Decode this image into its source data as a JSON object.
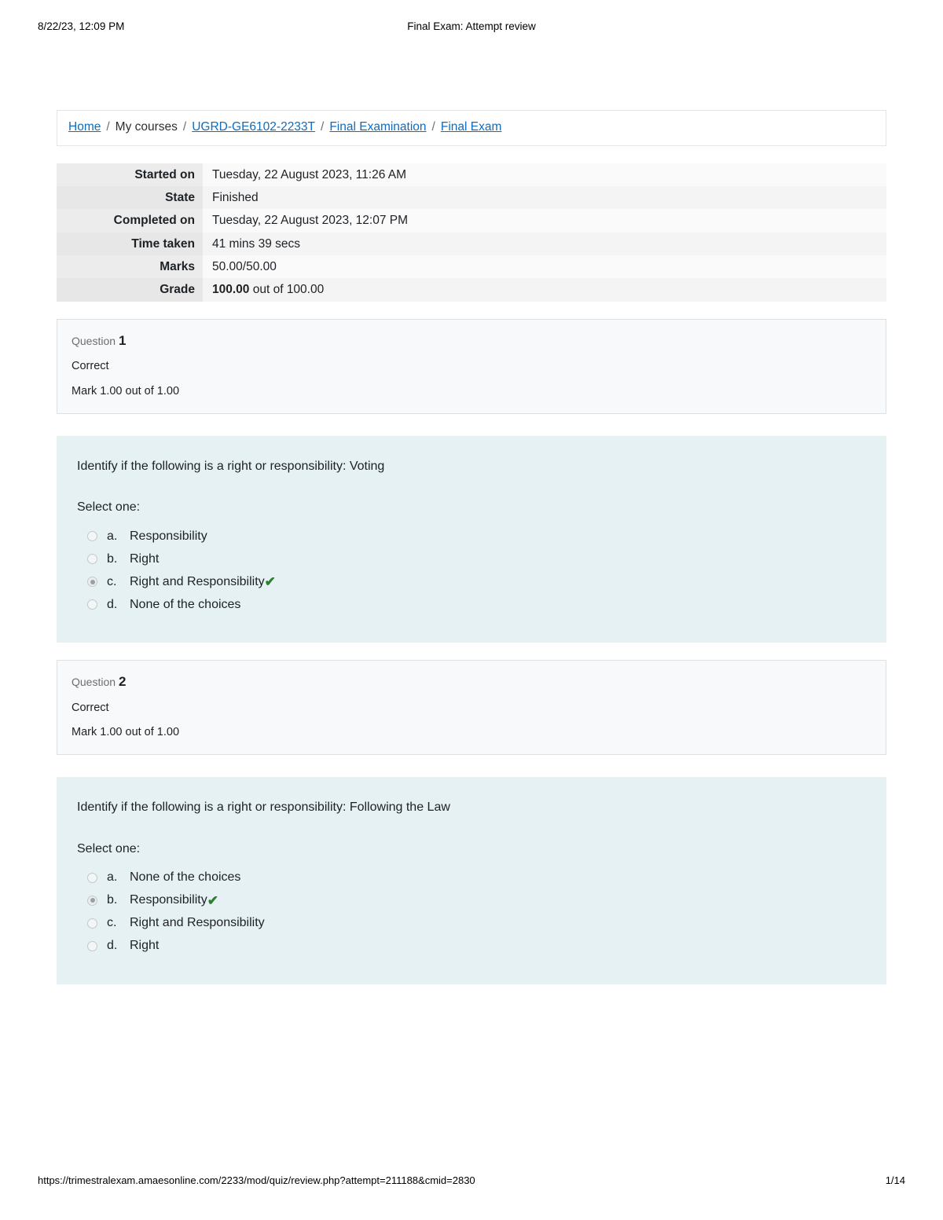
{
  "print_header": {
    "left": "8/22/23, 12:09 PM",
    "center": "Final Exam: Attempt review"
  },
  "print_footer": {
    "url": "https://trimestralexam.amaesonline.com/2233/mod/quiz/review.php?attempt=211188&cmid=2830",
    "page": "1/14"
  },
  "breadcrumb": {
    "separator": "/",
    "items": [
      {
        "label": "Home",
        "link": true
      },
      {
        "label": "My courses",
        "link": false
      },
      {
        "label": "UGRD-GE6102-2233T",
        "link": true
      },
      {
        "label": "Final Examination",
        "link": true
      },
      {
        "label": "Final Exam",
        "link": true
      }
    ]
  },
  "summary": {
    "rows": [
      {
        "key": "Started on",
        "value": "Tuesday, 22 August 2023, 11:26 AM"
      },
      {
        "key": "State",
        "value": "Finished"
      },
      {
        "key": "Completed on",
        "value": "Tuesday, 22 August 2023, 12:07 PM"
      },
      {
        "key": "Time taken",
        "value": "41 mins 39 secs"
      },
      {
        "key": "Marks",
        "value": "50.00/50.00"
      },
      {
        "key": "Grade",
        "value_strong": "100.00",
        "value_rest": " out of 100.00"
      }
    ]
  },
  "questions": [
    {
      "label": "Question",
      "number": "1",
      "state": "Correct",
      "mark": "Mark 1.00 out of 1.00",
      "text": "Identify if the following is a right or responsibility: Voting",
      "prompt": "Select one:",
      "options": [
        {
          "letter": "a.",
          "text": "Responsibility",
          "selected": false,
          "correct_tick": false
        },
        {
          "letter": "b.",
          "text": "Right",
          "selected": false,
          "correct_tick": false
        },
        {
          "letter": "c.",
          "text": "Right and Responsibility",
          "selected": true,
          "correct_tick": true
        },
        {
          "letter": "d.",
          "text": "None of the choices",
          "selected": false,
          "correct_tick": false
        }
      ]
    },
    {
      "label": "Question",
      "number": "2",
      "state": "Correct",
      "mark": "Mark 1.00 out of 1.00",
      "text": "Identify if the following is a right or responsibility: Following the Law",
      "prompt": "Select one:",
      "options": [
        {
          "letter": "a.",
          "text": "None of the choices",
          "selected": false,
          "correct_tick": false
        },
        {
          "letter": "b.",
          "text": "Responsibility",
          "selected": true,
          "correct_tick": true
        },
        {
          "letter": "c.",
          "text": "Right and Responsibility",
          "selected": false,
          "correct_tick": false
        },
        {
          "letter": "d.",
          "text": "Right",
          "selected": false,
          "correct_tick": false
        }
      ]
    }
  ],
  "icons": {
    "correct_tick": "✔"
  },
  "colors": {
    "link": "#0f6cbf",
    "question_panel": "#e6f1f3",
    "tick_green": "#2e7d32"
  }
}
